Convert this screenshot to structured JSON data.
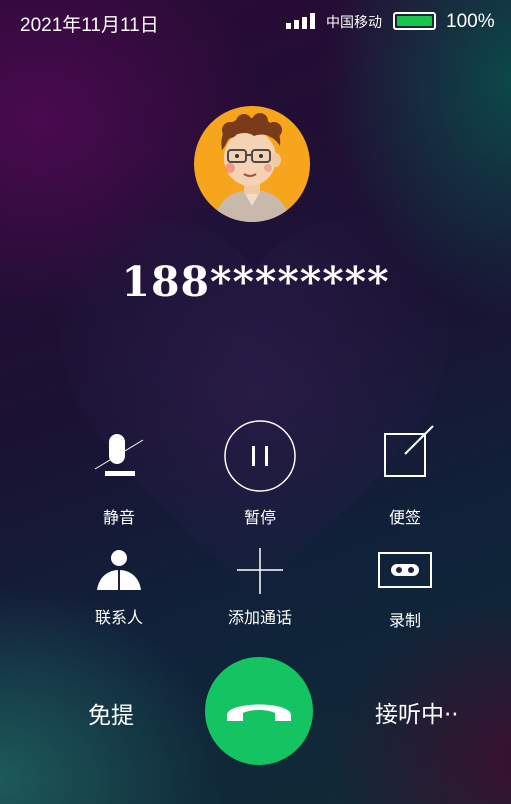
{
  "status_bar": {
    "date": "2021年11月11日",
    "carrier": "中国移动",
    "battery_percent": "100%",
    "battery_level": 1.0,
    "signal_icon": "signal-bars-icon",
    "battery_color": "#19c64d"
  },
  "caller": {
    "number": "188********",
    "avatar_icon": "cartoon-avatar-icon"
  },
  "controls": {
    "mute": {
      "label": "静音",
      "icon": "mute-mic-icon"
    },
    "pause": {
      "label": "暂停",
      "icon": "pause-icon"
    },
    "note": {
      "label": "便签",
      "icon": "note-edit-icon"
    },
    "contacts": {
      "label": "联系人",
      "icon": "contact-person-icon"
    },
    "add_call": {
      "label": "添加通话",
      "icon": "plus-icon"
    },
    "record": {
      "label": "录制",
      "icon": "record-tape-icon"
    }
  },
  "bottom": {
    "speaker_label": "免提",
    "call_state": "接听中··",
    "hangup_icon": "phone-hangup-icon",
    "hangup_color": "#14c463"
  }
}
